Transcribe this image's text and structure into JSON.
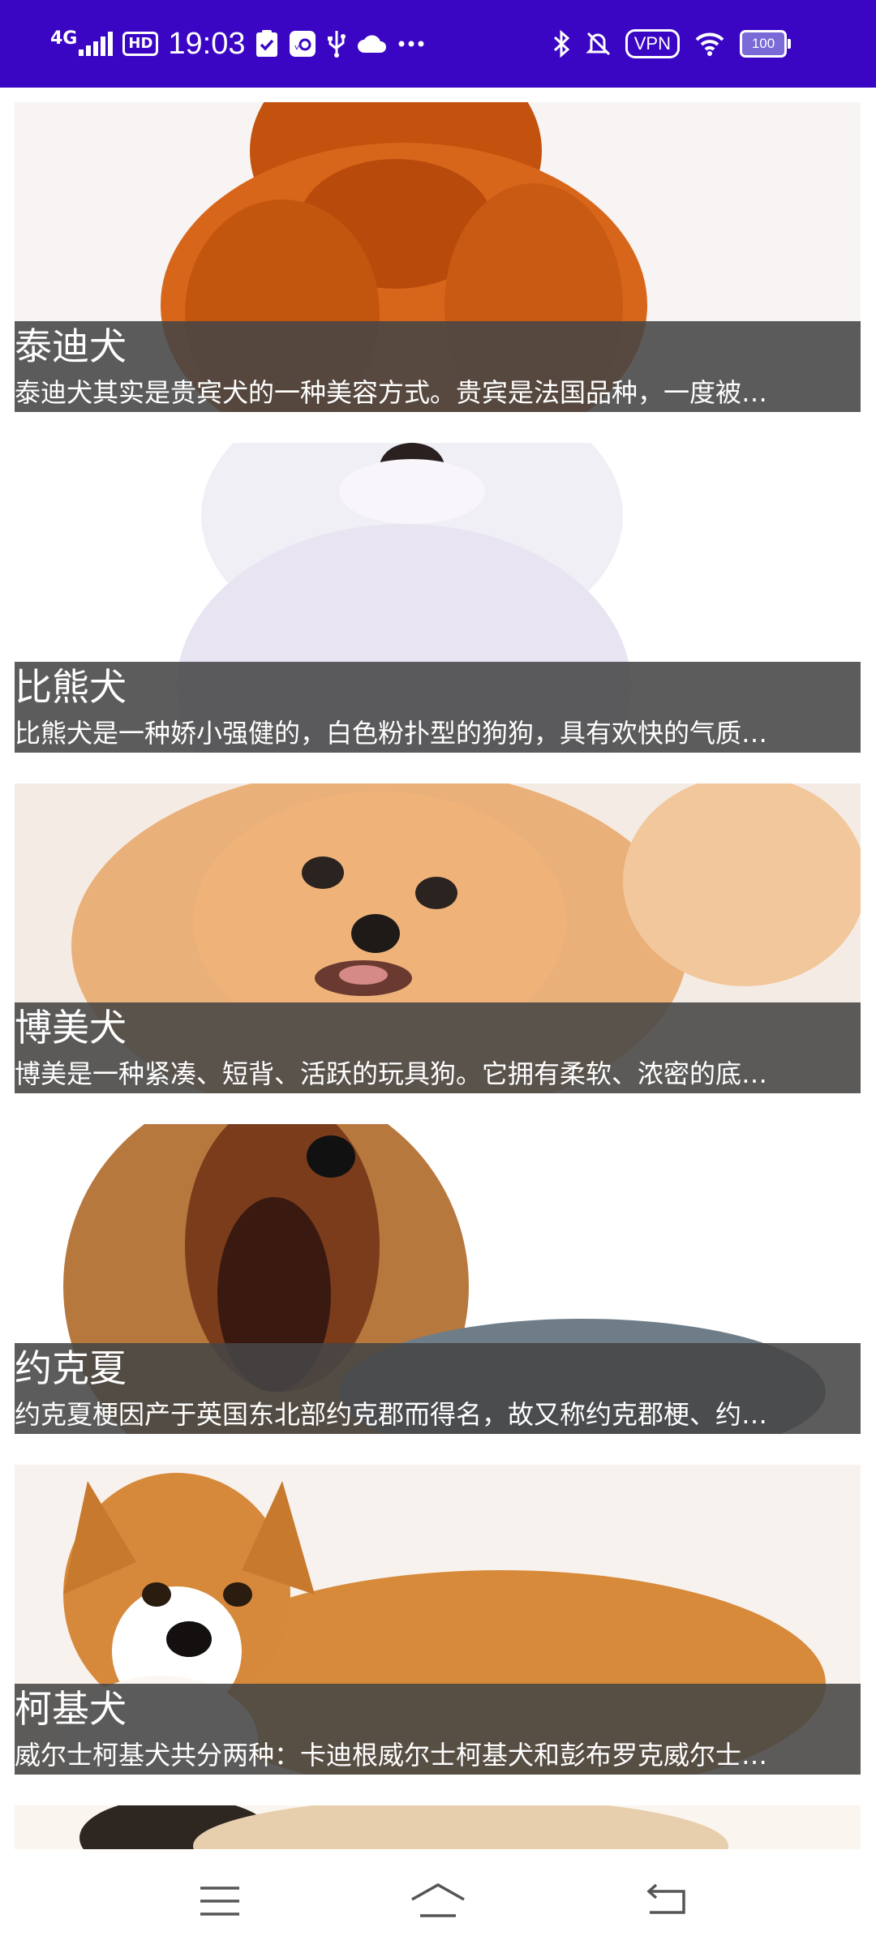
{
  "status_bar": {
    "network": "4G",
    "hd": "HD",
    "time": "19:03",
    "icons": [
      "clipboard-check-icon",
      "app-icon",
      "usb-icon",
      "cloud-icon",
      "more-dots-icon"
    ],
    "right_icons": [
      "bluetooth-icon",
      "mute-bell-icon",
      "wifi-icon"
    ],
    "vpn": "VPN",
    "battery": "100"
  },
  "breeds": [
    {
      "name": "泰迪犬",
      "desc": "泰迪犬其实是贵宾犬的一种美容方式。贵宾是法国品种，一度被…",
      "image": "teddy-dog-photo"
    },
    {
      "name": "比熊犬",
      "desc": "比熊犬是一种娇小强健的，白色粉扑型的狗狗，具有欢快的气质…",
      "image": "bichon-dog-photo"
    },
    {
      "name": "博美犬",
      "desc": "博美是一种紧凑、短背、活跃的玩具狗。它拥有柔软、浓密的底…",
      "image": "pomeranian-dog-photo"
    },
    {
      "name": "约克夏",
      "desc": "约克夏梗因产于英国东北部约克郡而得名，故又称约克郡梗、约…",
      "image": "yorkshire-dog-photo"
    },
    {
      "name": "柯基犬",
      "desc": "威尔士柯基犬共分两种：卡迪根威尔士柯基犬和彭布罗克威尔士…",
      "image": "corgi-dog-photo"
    }
  ],
  "nav": {
    "menu": "menu-icon",
    "home": "home-icon",
    "back": "back-icon"
  },
  "colors": {
    "status_bar": "#3a06c4",
    "overlay": "#464646"
  }
}
